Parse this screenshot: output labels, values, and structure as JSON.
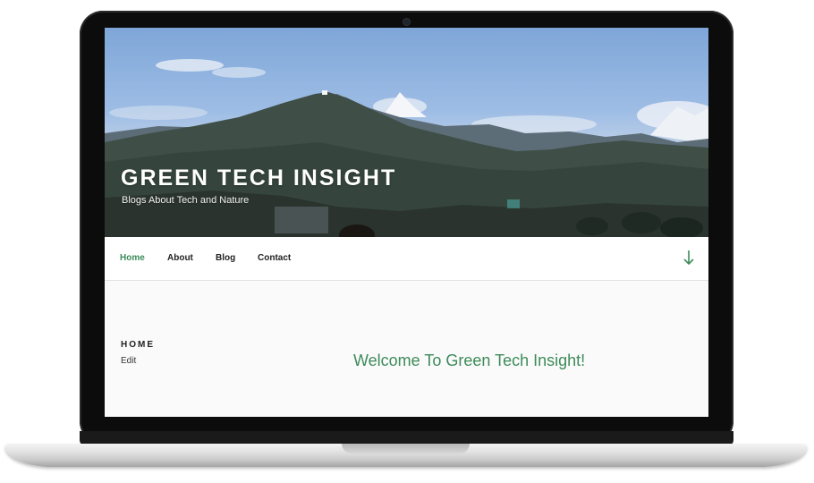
{
  "site": {
    "title": "GREEN TECH INSIGHT",
    "description": "Blogs About Tech and Nature"
  },
  "nav": {
    "items": [
      {
        "label": "Home",
        "active": true
      },
      {
        "label": "About",
        "active": false
      },
      {
        "label": "Blog",
        "active": false
      },
      {
        "label": "Contact",
        "active": false
      }
    ],
    "scroll_icon": "arrow-down-icon"
  },
  "page": {
    "heading": "HOME",
    "edit_label": "Edit",
    "welcome_text": "Welcome To Green Tech Insight!"
  },
  "colors": {
    "accent": "#3d8b5a",
    "frame": "#0c0c0c",
    "sky": "#8fb2df"
  }
}
